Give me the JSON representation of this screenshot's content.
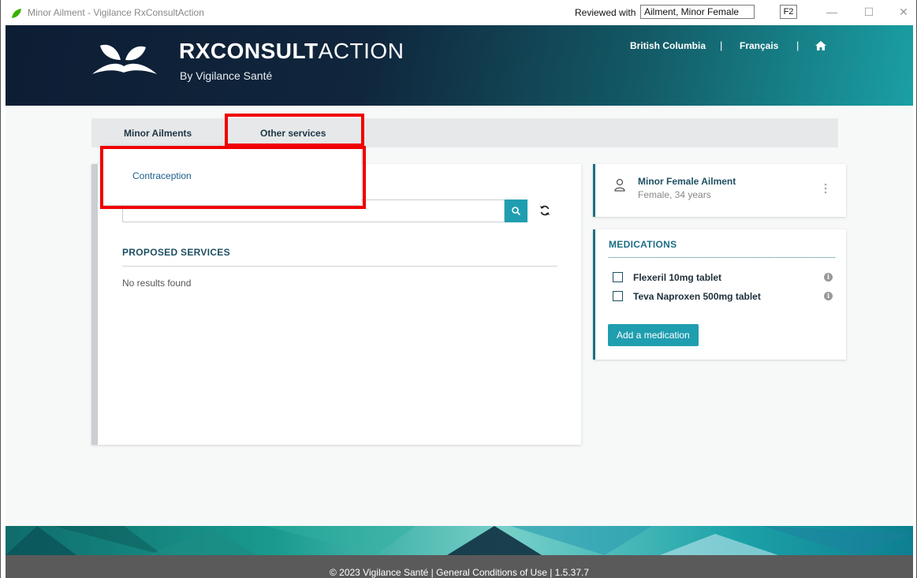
{
  "window": {
    "title": "Minor Ailment - Vigilance RxConsultAction",
    "reviewed_label": "Reviewed with",
    "reviewed_value": "Ailment, Minor Female",
    "shortcut": "F2",
    "controls": {
      "minimize": "—",
      "maximize": "☐",
      "close": "✕"
    }
  },
  "header": {
    "brand_bold": "RXCONSULT",
    "brand_light": "ACTION",
    "brand_sub": "By Vigilance Santé",
    "nav": {
      "province": "British Columbia",
      "separator": "|",
      "language": "Français"
    }
  },
  "tabs": {
    "minor_ailments": "Minor Ailments",
    "other_services": "Other services"
  },
  "dropdown": {
    "items": [
      "Contraception"
    ]
  },
  "proposed": {
    "title": "PROPOSED SERVICES",
    "empty": "No results found"
  },
  "patient": {
    "name": "Minor Female Ailment",
    "details": "Female, 34 years"
  },
  "medications": {
    "title": "MEDICATIONS",
    "items": [
      {
        "label": "Flexeril 10mg tablet",
        "checked": false
      },
      {
        "label": "Teva Naproxen 500mg tablet",
        "checked": false
      }
    ],
    "add_label": "Add a medication"
  },
  "footer": {
    "text": "© 2023 Vigilance Santé | General Conditions of Use | 1.5.37.7"
  },
  "colors": {
    "accent": "#1f9eb0",
    "highlight": "#f00000",
    "header_dark": "#0d1d34",
    "footer": "#5a5a5a"
  },
  "icons": [
    "leaf-icon",
    "search-icon",
    "refresh-icon",
    "home-icon",
    "user-icon",
    "more-vertical-icon",
    "info-icon",
    "checkbox"
  ]
}
